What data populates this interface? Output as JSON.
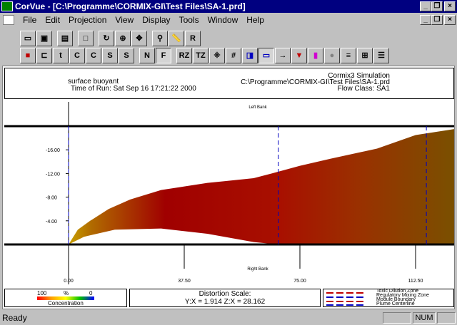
{
  "window": {
    "title": "CorVue - [C:\\Programme\\CORMIX-GI\\Test Files\\SA-1.prd]"
  },
  "menu": [
    "File",
    "Edit",
    "Projection",
    "View",
    "Display",
    "Tools",
    "Window",
    "Help"
  ],
  "toolbar": {
    "row2_labels": [
      "N",
      "F",
      "RZ",
      "TZ"
    ]
  },
  "header": {
    "left_line1": "surface buoyant",
    "left_line2": "Time of Run:  Sat Sep 16 17:21:22 2000",
    "right_line1": "Cormix3 Simulation",
    "right_line2": "C:\\Programme\\CORMIX-GI\\Test Files\\SA-1.prd",
    "right_line3": "Flow Class:  SA1"
  },
  "chart_data": {
    "type": "area",
    "title": "",
    "top_label": "Left Bank",
    "bottom_label": "Right Bank",
    "x_ticks": [
      "0.00",
      "37.50",
      "75.00",
      "112.50"
    ],
    "x_tick_values": [
      0,
      37.5,
      75,
      112.5
    ],
    "xlim": [
      0,
      125
    ],
    "y_ticks": [
      "-16.00",
      "-12.00",
      "-8.00",
      "-4.00"
    ],
    "y_tick_values": [
      -16,
      -12,
      -8,
      -4
    ],
    "ylim": [
      -20,
      0
    ],
    "bank_y": [
      -20,
      0
    ],
    "module_boundaries_x": [
      0,
      68,
      116
    ],
    "plume_upper": [
      [
        0,
        0
      ],
      [
        3,
        -2.5
      ],
      [
        7,
        -4
      ],
      [
        13,
        -6
      ],
      [
        20,
        -7.6
      ],
      [
        30,
        -9.2
      ],
      [
        45,
        -10.4
      ],
      [
        60,
        -11.2
      ],
      [
        68,
        -12.3
      ],
      [
        75,
        -13.3
      ],
      [
        85,
        -14.5
      ],
      [
        100,
        -16.2
      ],
      [
        112.5,
        -18.5
      ],
      [
        125,
        -19.5
      ]
    ],
    "plume_lower": [
      [
        0,
        0
      ],
      [
        5,
        -1.3
      ],
      [
        15,
        -2.5
      ],
      [
        30,
        -2.7
      ],
      [
        45,
        -1.8
      ],
      [
        60,
        -0.4
      ],
      [
        68,
        0
      ],
      [
        125,
        0
      ]
    ],
    "colors": {
      "bank": "#000000",
      "module_boundary": "#0000c0",
      "plume_near": "#c8a000",
      "plume_mid": "#a00000",
      "plume_far": "#7a5000"
    }
  },
  "legend": {
    "conc_left": "100",
    "conc_mid": "%",
    "conc_right": "0",
    "conc_label": "Concentration",
    "distortion_title": "Distortion Scale:",
    "distortion_values": "Y:X = 1.914   Z:X = 28.162",
    "key_items": [
      "Toxic Dilution Zone",
      "Regulatory Mixing Zone",
      "Module Boundary",
      "Plume Centerline"
    ]
  },
  "status": {
    "text": "Ready",
    "num": "NUM"
  }
}
